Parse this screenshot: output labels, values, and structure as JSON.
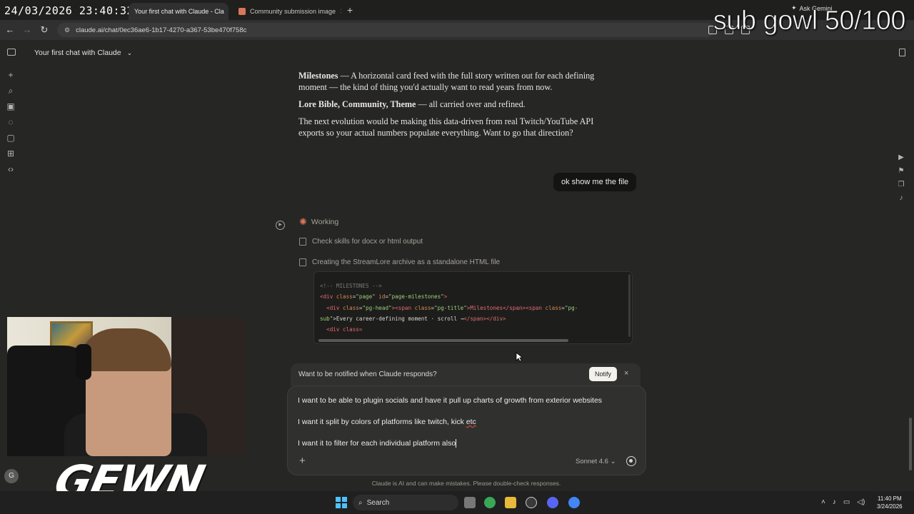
{
  "overlay": {
    "timestamp": "24/03/2026 23:40:32",
    "sub_goal": "sub gowl 50/100",
    "logo": "GEWN"
  },
  "browser": {
    "tabs": [
      {
        "label": "Your first chat with Claude - Cla",
        "active": true
      },
      {
        "label": "Community submission image",
        "active": false
      }
    ],
    "url": "claude.ai/chat/0ec36ae6-1b17-4270-a367-53be470f758c",
    "ask_gemini": "Ask Gemini"
  },
  "chat": {
    "title": "Your first chat with Claude",
    "assistant_paragraphs": {
      "milestones_bold": "Milestones",
      "milestones_text": " — A horizontal card feed with the full story written out for each defining moment — the kind of thing you'd actually want to read years from now.",
      "lore_bold": "Lore Bible, Community, Theme",
      "lore_text": " — all carried over and refined.",
      "next": "The next evolution would be making this data-driven from real Twitch/YouTube API exports so your actual numbers populate everything. Want to go that direction?"
    },
    "user_message": "ok show me the file",
    "working_label": "Working",
    "steps": [
      "Check skills for docx or html output",
      "Creating the StreamLore archive as a standalone HTML file"
    ],
    "code": {
      "line1": "<!-- MILESTONES -->",
      "line2_a": "<div ",
      "line2_b": "class",
      "line2_c": "=",
      "line2_d": "\"page\"",
      "line2_e": " id",
      "line2_f": "=",
      "line2_g": "\"page-milestones\"",
      "line2_h": ">",
      "line3_a": "  <div ",
      "line3_b": "class",
      "line3_c": "=",
      "line3_d": "\"pg-head\"",
      "line3_e": "><span ",
      "line3_f": "class",
      "line3_g": "=",
      "line3_h": "\"pg-title\"",
      "line3_i": ">Milestones</span><span ",
      "line3_j": "class",
      "line3_k": "=",
      "line3_l": "\"pg-",
      "line4_a": "sub\"",
      "line4_b": ">Every career-defining moment · scroll →",
      "line4_c": "</span></div>",
      "line5": "  <div class="
    },
    "notify": {
      "text": "Want to be notified when Claude responds?",
      "button": "Notify",
      "close": "×"
    },
    "composer": {
      "line1": "I want to be able to plugin socials and have it pull up charts of growth from exterior websites",
      "line2_a": "I want it split by colors of platforms like twitch, kick ",
      "line2_b": "etc",
      "line3": "I want it to filter for each individual platform also",
      "add": "+",
      "model": "Sonnet 4.6 ⌄"
    },
    "disclaimer": "Claude is AI and can make mistakes. Please double-check responses.",
    "avatar_initial": "G"
  },
  "taskbar": {
    "search": "Search",
    "time": "11:40 PM",
    "date": "3/24/2026"
  },
  "colors": {
    "accent": "#d97757",
    "background": "#262624",
    "composer": "#30302e"
  }
}
